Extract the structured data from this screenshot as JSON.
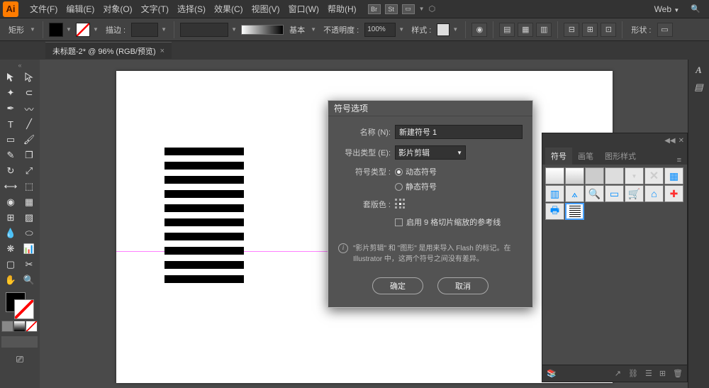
{
  "app": {
    "logo": "Ai",
    "workspace": "Web"
  },
  "menu": {
    "items": [
      "文件(F)",
      "编辑(E)",
      "对象(O)",
      "文字(T)",
      "选择(S)",
      "效果(C)",
      "视图(V)",
      "窗口(W)",
      "帮助(H)"
    ],
    "icon_labels": [
      "Br",
      "St"
    ]
  },
  "control": {
    "shape_label": "矩形",
    "stroke_label": "描边 :",
    "stroke_value": "",
    "style_value": "基本",
    "opacity_label": "不透明度 :",
    "opacity_value": "100%",
    "doc_style_label": "样式 :",
    "shape_btn_label": "形状 :"
  },
  "document": {
    "tab_title": "未标题-2* @ 96% (RGB/预览)"
  },
  "dialog": {
    "title": "符号选项",
    "name_label": "名称 (N):",
    "name_value": "新建符号 1",
    "export_label": "导出类型 (E):",
    "export_value": "影片剪辑",
    "type_label": "符号类型 :",
    "type_dynamic": "动态符号",
    "type_static": "静态符号",
    "registration_label": "套版色 :",
    "slice_label": "启用 9 格切片缩放的参考线",
    "info_text": "\"影片剪辑\" 和 \"图形\" 是用来导入 Flash 的标记。在 Illustrator 中，这两个符号之间没有差异。",
    "ok": "确定",
    "cancel": "取消"
  },
  "symbol_panel": {
    "tabs": [
      "符号",
      "画笔",
      "图形样式"
    ]
  },
  "chart_data": null
}
